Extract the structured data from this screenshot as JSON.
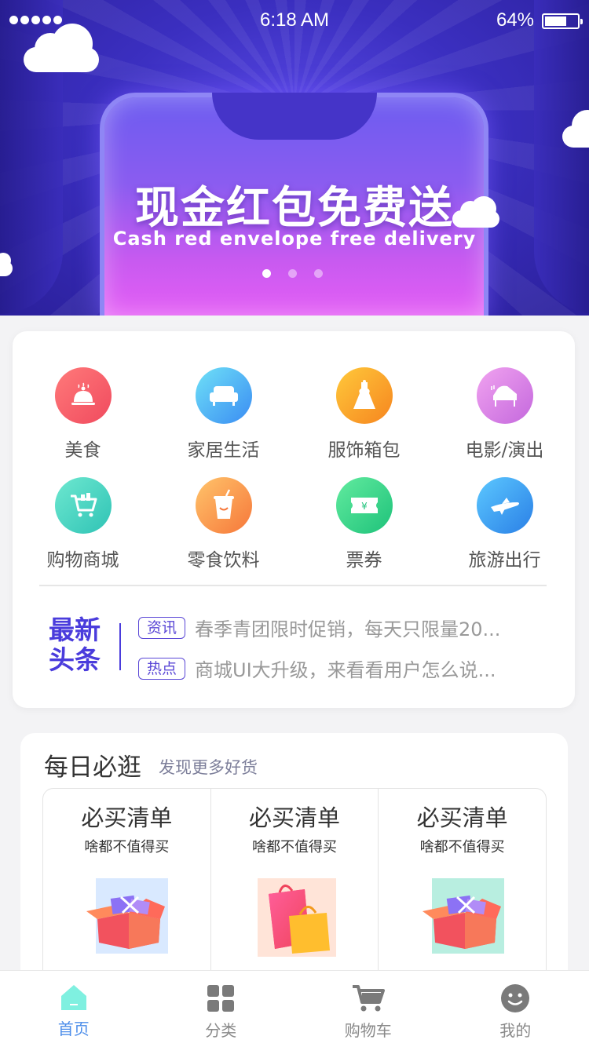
{
  "status_bar": {
    "time": "6:18 AM",
    "battery": "64%"
  },
  "banner": {
    "title": "现金红包免费送",
    "subtitle": "Cash red envelope free delivery",
    "dots": 3,
    "active_dot": 0
  },
  "categories": [
    {
      "label": "美食",
      "icon": "food-cloche-icon",
      "color": "#f5556b"
    },
    {
      "label": "家居生活",
      "icon": "sofa-icon",
      "color": "#42a7f5"
    },
    {
      "label": "服饰箱包",
      "icon": "dress-icon",
      "color": "#f6a21e"
    },
    {
      "label": "电影/演出",
      "icon": "piano-icon",
      "color": "#d77ee2"
    },
    {
      "label": "购物商城",
      "icon": "shopping-cart-icon",
      "color": "#3fd2b8"
    },
    {
      "label": "零食饮料",
      "icon": "drink-cup-icon",
      "color": "#f68f3c"
    },
    {
      "label": "票券",
      "icon": "ticket-icon",
      "color": "#2fd48a"
    },
    {
      "label": "旅游出行",
      "icon": "airplane-icon",
      "color": "#2f96ee"
    }
  ],
  "news": {
    "title_line1": "最新",
    "title_line2": "头条",
    "items": [
      {
        "tag": "资讯",
        "text": "春季青团限时促销，每天只限量20..."
      },
      {
        "tag": "热点",
        "text": "商城UI大升级，来看看用户怎么说..."
      }
    ]
  },
  "daily": {
    "title": "每日必逛",
    "subtitle": "发现更多好货",
    "cells": [
      {
        "title": "必买清单",
        "subtitle": "啥都不值得买",
        "art": "gift-box-icon"
      },
      {
        "title": "必买清单",
        "subtitle": "啥都不值得买",
        "art": "shopping-bags-icon"
      },
      {
        "title": "必买清单",
        "subtitle": "啥都不值得买",
        "art": "gift-box-icon"
      }
    ]
  },
  "tabbar": [
    {
      "label": "首页",
      "icon": "home-icon",
      "active": true
    },
    {
      "label": "分类",
      "icon": "grid-icon",
      "active": false
    },
    {
      "label": "购物车",
      "icon": "cart-icon",
      "active": false
    },
    {
      "label": "我的",
      "icon": "smiley-icon",
      "active": false
    }
  ]
}
